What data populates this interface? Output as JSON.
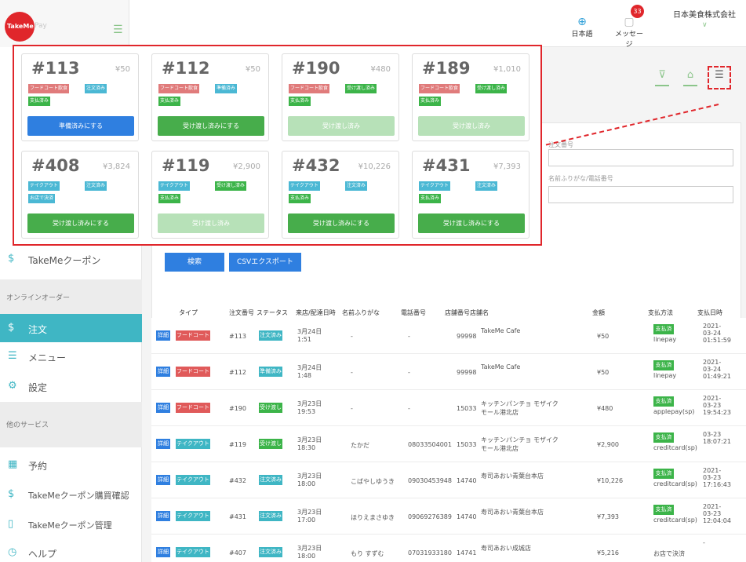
{
  "header": {
    "logo_text": "TakeMe",
    "logo_suffix": "Pay",
    "language_label": "日本語",
    "message_label": "メッセージ",
    "message_count": "33",
    "company_name": "日本美食株式会社"
  },
  "sidebar": {
    "items": [
      {
        "label": "TakeMeクーポン",
        "icon": "dollar-icon"
      },
      {
        "section": "オンラインオーダー"
      },
      {
        "label": "注文",
        "icon": "dollar-icon",
        "active": true
      },
      {
        "label": "メニュー",
        "icon": "list-icon"
      },
      {
        "label": "設定",
        "icon": "gear-icon"
      },
      {
        "section": "他のサービス"
      },
      {
        "label": "予約",
        "icon": "calendar-icon"
      },
      {
        "label": "TakeMeクーポン購買確認",
        "icon": "dollar-icon"
      },
      {
        "label": "TakeMeクーポン管理",
        "icon": "doc-icon"
      },
      {
        "label": "ヘルプ",
        "icon": "help-icon"
      }
    ]
  },
  "search": {
    "label_order_no": "注文番号",
    "label_name_phone": "名前ふりがな/電話番号",
    "search_button": "検索",
    "csv_button": "CSVエクスポート"
  },
  "table": {
    "headers": [
      "タイプ",
      "注文番号",
      "ステータス",
      "来店/配達日時",
      "名前ふりがな",
      "電話番号",
      "店舗番号",
      "店舗名",
      "金額",
      "支払方法",
      "支払日時"
    ],
    "detail_label": "詳細",
    "rows": [
      {
        "type": "フードコート飲食",
        "type_color": "red",
        "order": "#113",
        "status": "注文済み",
        "status_color": "teal",
        "datetime": "3月24日 1:51",
        "name": "-",
        "phone": "-",
        "store_no": "99998",
        "store": "TakeMe Cafe",
        "amount": "¥50",
        "pay_badge": "支払済み",
        "pay_method": "linepay",
        "paid_at": "2021-03-24 01:51:59"
      },
      {
        "type": "フードコート飲食",
        "type_color": "red",
        "order": "#112",
        "status": "準備済み",
        "status_color": "teal",
        "datetime": "3月24日 1:48",
        "name": "-",
        "phone": "-",
        "store_no": "99998",
        "store": "TakeMe Cafe",
        "amount": "¥50",
        "pay_badge": "支払済み",
        "pay_method": "linepay",
        "paid_at": "2021-03-24 01:49:21"
      },
      {
        "type": "フードコート飲食",
        "type_color": "red",
        "order": "#190",
        "status": "受け渡し済み",
        "status_color": "green",
        "datetime": "3月23日 19:53",
        "name": "-",
        "phone": "-",
        "store_no": "15033",
        "store": "キッチンパンチョ モザイクモール港北店",
        "amount": "¥480",
        "pay_badge": "支払済み",
        "pay_method": "applepay(sp)",
        "paid_at": "2021-03-23 19:54:23"
      },
      {
        "type": "テイクアウト",
        "type_color": "teal",
        "order": "#119",
        "status": "受け渡し済み",
        "status_color": "green",
        "datetime": "3月23日 18:30",
        "name": "たかだ",
        "phone": "08033504001",
        "store_no": "15033",
        "store": "キッチンパンチョ モザイクモール港北店",
        "amount": "¥2,900",
        "pay_badge": "支払済み",
        "pay_method": "creditcard(sp)",
        "paid_at": "03-23 18:07:21"
      },
      {
        "type": "テイクアウト",
        "type_color": "teal",
        "order": "#432",
        "status": "注文済み",
        "status_color": "teal",
        "datetime": "3月23日 18:00",
        "name": "こばやしゆうき",
        "phone": "09030453948",
        "store_no": "14740",
        "store": "寿司あおい青葉台本店",
        "amount": "¥10,226",
        "pay_badge": "支払済み",
        "pay_method": "creditcard(sp)",
        "paid_at": "2021-03-23 17:16:43"
      },
      {
        "type": "テイクアウト",
        "type_color": "teal",
        "order": "#431",
        "status": "注文済み",
        "status_color": "teal",
        "datetime": "3月23日 17:00",
        "name": "ほりえまさゆき",
        "phone": "09069276389",
        "store_no": "14740",
        "store": "寿司あおい青葉台本店",
        "amount": "¥7,393",
        "pay_badge": "支払済み",
        "pay_method": "creditcard(sp)",
        "paid_at": "2021-03-23 12:04:04"
      },
      {
        "type": "テイクアウト",
        "type_color": "teal",
        "order": "#407",
        "status": "注文済み",
        "status_color": "teal",
        "datetime": "3月23日 18:00",
        "name": "もり すずむ",
        "phone": "07031933180",
        "store_no": "14741",
        "store": "寿司あおい成城店",
        "amount": "¥5,216",
        "pay_badge": "",
        "pay_method": "お店で決済",
        "paid_at": "-"
      }
    ]
  },
  "cards": [
    {
      "num": "#113",
      "amt": "¥50",
      "tags": [
        [
          "フードコート飲食",
          "red"
        ],
        [
          "注文済み",
          "teal"
        ],
        [
          "支払済み",
          "green"
        ]
      ],
      "btn": "準備済みにする",
      "btn_style": "blue"
    },
    {
      "num": "#112",
      "amt": "¥50",
      "tags": [
        [
          "フードコート飲食",
          "red"
        ],
        [
          "準備済み",
          "teal"
        ],
        [
          "支払済み",
          "green"
        ]
      ],
      "btn": "受け渡し済みにする",
      "btn_style": "green"
    },
    {
      "num": "#190",
      "amt": "¥480",
      "tags": [
        [
          "フードコート飲食",
          "red"
        ],
        [
          "受け渡し済み",
          "green"
        ],
        [
          "支払済み",
          "green"
        ]
      ],
      "btn": "受け渡し済み",
      "btn_style": "pale"
    },
    {
      "num": "#189",
      "amt": "¥1,010",
      "tags": [
        [
          "フードコート飲食",
          "red"
        ],
        [
          "受け渡し済み",
          "green"
        ],
        [
          "支払済み",
          "green"
        ]
      ],
      "btn": "受け渡し済み",
      "btn_style": "pale"
    },
    {
      "num": "#408",
      "amt": "¥3,824",
      "tags": [
        [
          "テイクアウト",
          "teal"
        ],
        [
          "注文済み",
          "teal"
        ],
        [
          "お店で決済",
          "teal"
        ]
      ],
      "btn": "受け渡し済みにする",
      "btn_style": "green"
    },
    {
      "num": "#119",
      "amt": "¥2,900",
      "tags": [
        [
          "テイクアウト",
          "teal"
        ],
        [
          "受け渡し済み",
          "green"
        ],
        [
          "支払済み",
          "green"
        ]
      ],
      "btn": "受け渡し済み",
      "btn_style": "pale"
    },
    {
      "num": "#432",
      "amt": "¥10,226",
      "tags": [
        [
          "テイクアウト",
          "teal"
        ],
        [
          "注文済み",
          "teal"
        ],
        [
          "支払済み",
          "green"
        ]
      ],
      "btn": "受け渡し済みにする",
      "btn_style": "green"
    },
    {
      "num": "#431",
      "amt": "¥7,393",
      "tags": [
        [
          "テイクアウト",
          "teal"
        ],
        [
          "注文済み",
          "teal"
        ],
        [
          "支払済み",
          "green"
        ]
      ],
      "btn": "受け渡し済みにする",
      "btn_style": "green"
    }
  ],
  "colors": {
    "accent_red": "#e0262b",
    "teal": "#3fb6c4",
    "green": "#3cb449",
    "blue": "#2f7fe0"
  }
}
